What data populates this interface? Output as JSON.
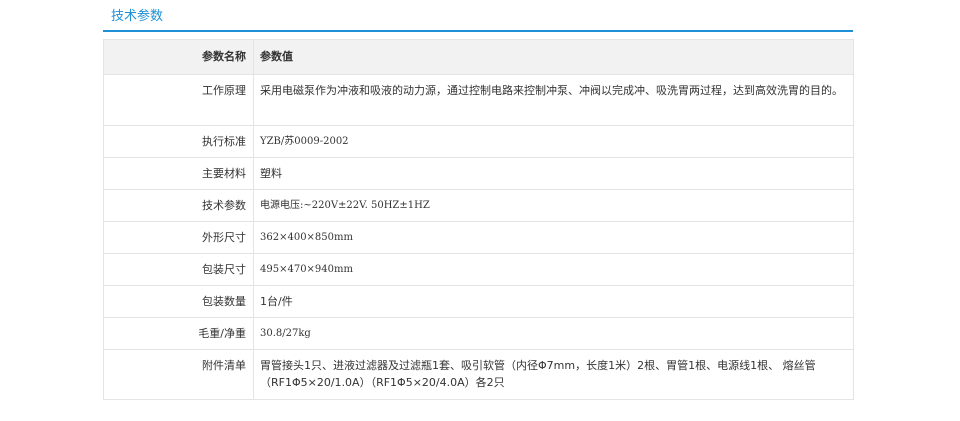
{
  "section": {
    "title": "技术参数",
    "accent_color": "#1e90d8"
  },
  "table": {
    "header": {
      "name": "参数名称",
      "value": "参数值"
    },
    "rows": [
      {
        "name": "工作原理",
        "value": "采用电磁泵作为冲液和吸液的动力源，通过控制电路来控制冲泵、冲阀以完成冲、吸洗胃两过程，达到高效洗胃的目的。"
      },
      {
        "name": "执行标准",
        "value": "YZB/苏0009-2002"
      },
      {
        "name": "主要材料",
        "value": "塑料"
      },
      {
        "name": "技术参数",
        "value": "电源电压:~220V±22V. 50HZ±1HZ"
      },
      {
        "name": "外形尺寸",
        "value": "362×400×850mm"
      },
      {
        "name": "包装尺寸",
        "value": "495×470×940mm"
      },
      {
        "name": "包装数量",
        "value": "1台/件"
      },
      {
        "name": "毛重/净重",
        "value": "30.8/27kg"
      },
      {
        "name": "附件清单",
        "value": "胃管接头1只、进液过滤器及过滤瓶1套、吸引软管（内径Φ7mm，长度1米）2根、胃管1根、电源线1根、 熔丝管（RF1Φ5×20/1.0A）（RF1Φ5×20/4.0A）各2只"
      }
    ]
  }
}
